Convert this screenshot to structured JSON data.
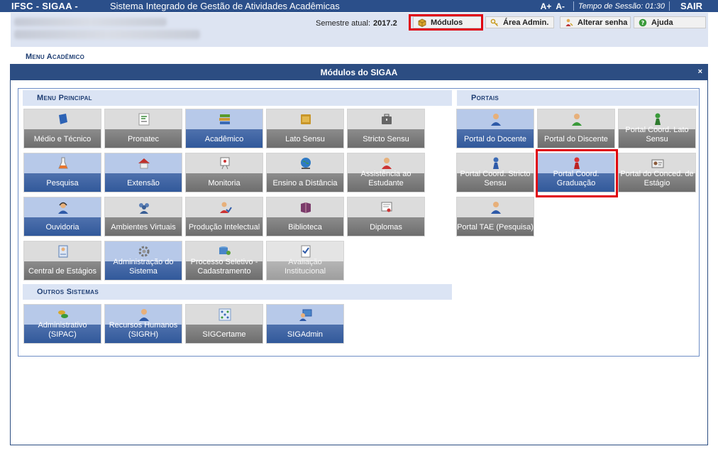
{
  "header": {
    "brand": "IFSC - SIGAA -",
    "system_name": "Sistema Integrado de Gestão de Atividades Acadêmicas",
    "font_increase": "A+",
    "font_decrease": "A-",
    "session_label": "Tempo de Sessão: 01:30",
    "logout": "SAIR"
  },
  "infobar": {
    "semestre_label": "Semestre atual:",
    "semestre_value": "2017.2",
    "buttons": [
      "Módulos",
      "Área Admin.",
      "Alterar senha",
      "Ajuda"
    ]
  },
  "menu_label": "Menu Acadêmico",
  "modal": {
    "title": "Módulos do SIGAA",
    "close": "×",
    "sections": {
      "principal": "Menu Principal",
      "portais": "Portais",
      "outros": "Outros Sistemas"
    },
    "principal": [
      "Médio e Técnico",
      "Pronatec",
      "Acadêmico",
      "Lato Sensu",
      "Stricto Sensu",
      "Pesquisa",
      "Extensão",
      "Monitoria",
      "Ensino a Distância",
      "Assistência ao Estudante",
      "Ouvidoria",
      "Ambientes Virtuais",
      "Produção Intelectual",
      "Biblioteca",
      "Diplomas",
      "Central de Estágios",
      "Administração do Sistema",
      "Processo Seletivo - Cadastramento",
      "Avaliação Institucional"
    ],
    "portais": [
      "Portal do Docente",
      "Portal do Discente",
      "Portal Coord. Lato Sensu",
      "Portal Coord. Stricto Sensu",
      "Portal Coord. Graduação",
      "Portal do Conced. de Estágio",
      "Portal TAE (Pesquisa)"
    ],
    "outros": [
      "Administrativo (SIPAC)",
      "Recursos Humanos (SIGRH)",
      "SIGCertame",
      "SIGAdmin"
    ]
  },
  "icons": {
    "modulos": "cube-icon",
    "area_admin": "key-icon",
    "alterar_senha": "person-key-icon",
    "ajuda": "help-icon"
  },
  "colors": {
    "header_bg": "#2b4f8a",
    "tile_blue": "#2f5799",
    "tile_gray": "#6b6b6b",
    "highlight": "#e0000f"
  }
}
